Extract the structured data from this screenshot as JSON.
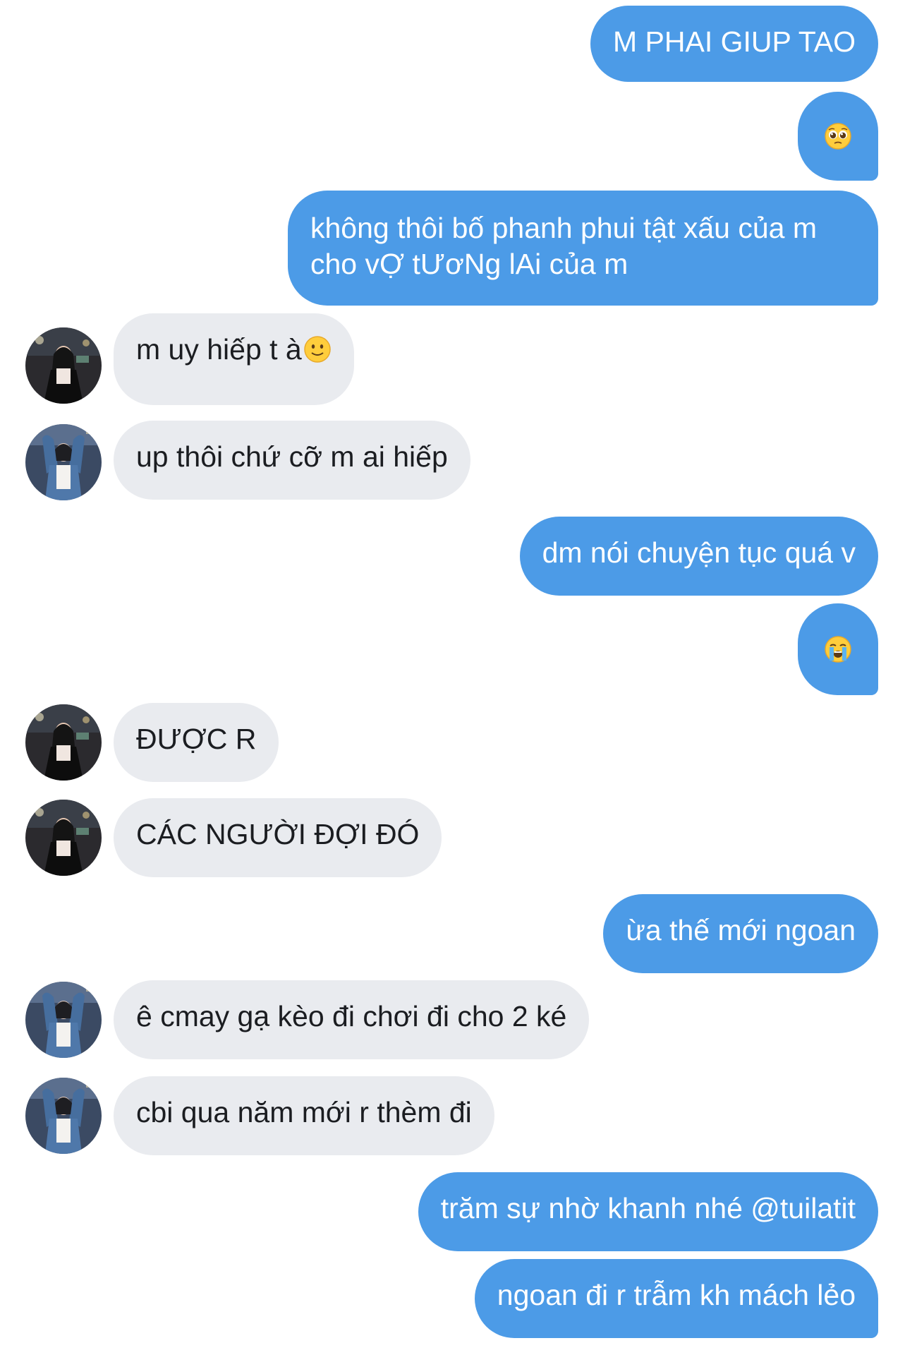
{
  "messages": [
    {
      "dir": "out",
      "text": "M PHAI GIUP TAO"
    },
    {
      "dir": "out",
      "emoji": "pleading-face"
    },
    {
      "dir": "out",
      "text": "không thôi bố phanh phui tật xấu của m cho vỢ tƯơNg lAi của m"
    },
    {
      "dir": "in",
      "text": "m uy hiếp t à",
      "emoji": "slightly-smiling-face",
      "avatar": "avatar-a"
    },
    {
      "dir": "in",
      "text": "up thôi chứ cỡ m ai hiếp",
      "avatar": "avatar-b"
    },
    {
      "dir": "out",
      "text": "dm nói chuyện tục quá v"
    },
    {
      "dir": "out",
      "emoji": "loudly-crying-face"
    },
    {
      "dir": "in",
      "text": "ĐƯỢC R",
      "avatar": "avatar-a"
    },
    {
      "dir": "in",
      "text": "CÁC NGƯỜI ĐỢI ĐÓ",
      "avatar": "avatar-a"
    },
    {
      "dir": "out",
      "text": "ừa thế mới ngoan"
    },
    {
      "dir": "in",
      "text": "ê cmay gạ kèo đi chơi đi cho 2 ké",
      "avatar": "avatar-b"
    },
    {
      "dir": "in",
      "text": "cbi qua năm mới r thèm đi",
      "avatar": "avatar-b"
    },
    {
      "dir": "out",
      "text": "trăm sự nhờ khanh nhé @tuilatit"
    },
    {
      "dir": "out",
      "text": "ngoan đi r trẫm kh mách lẻo"
    }
  ],
  "colors": {
    "outgoing_bubble": "#4c9be7",
    "incoming_bubble": "#e9ebef",
    "outgoing_text": "#ffffff",
    "incoming_text": "#1b1d21"
  }
}
